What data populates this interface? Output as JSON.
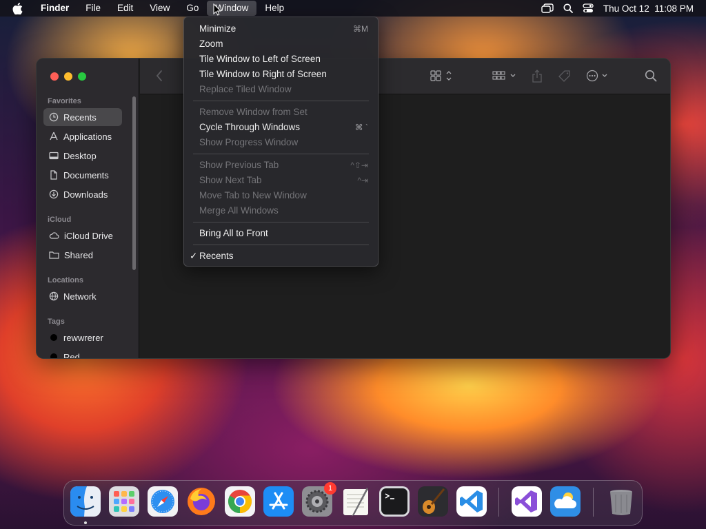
{
  "menubar": {
    "app_name": "Finder",
    "items": [
      "File",
      "Edit",
      "View",
      "Go",
      "Window",
      "Help"
    ],
    "active_menu": "Window",
    "clock": "Thu Oct 12  11:08 PM"
  },
  "window_menu": {
    "items": [
      {
        "label": "Minimize",
        "shortcut": "⌘M",
        "enabled": true
      },
      {
        "label": "Zoom",
        "shortcut": "",
        "enabled": true
      },
      {
        "label": "Tile Window to Left of Screen",
        "shortcut": "",
        "enabled": true
      },
      {
        "label": "Tile Window to Right of Screen",
        "shortcut": "",
        "enabled": true
      },
      {
        "label": "Replace Tiled Window",
        "shortcut": "",
        "enabled": false
      },
      {
        "label": "Remove Window from Set",
        "shortcut": "",
        "enabled": false
      },
      {
        "label": "Cycle Through Windows",
        "shortcut": "⌘ `",
        "enabled": true
      },
      {
        "label": "Show Progress Window",
        "shortcut": "",
        "enabled": false
      },
      {
        "label": "Show Previous Tab",
        "shortcut": "^⇧⇥",
        "enabled": false
      },
      {
        "label": "Show Next Tab",
        "shortcut": "^⇥",
        "enabled": false
      },
      {
        "label": "Move Tab to New Window",
        "shortcut": "",
        "enabled": false
      },
      {
        "label": "Merge All Windows",
        "shortcut": "",
        "enabled": false
      },
      {
        "label": "Bring All to Front",
        "shortcut": "",
        "enabled": true
      },
      {
        "label": "Recents",
        "shortcut": "",
        "enabled": true,
        "checked": true
      }
    ]
  },
  "sidebar": {
    "sections": {
      "favorites": "Favorites",
      "icloud": "iCloud",
      "locations": "Locations",
      "tags": "Tags"
    },
    "favorites": [
      {
        "label": "Recents",
        "icon": "clock-icon",
        "selected": true
      },
      {
        "label": "Applications",
        "icon": "applications-icon"
      },
      {
        "label": "Desktop",
        "icon": "desktop-icon"
      },
      {
        "label": "Documents",
        "icon": "document-icon"
      },
      {
        "label": "Downloads",
        "icon": "download-icon"
      }
    ],
    "icloud": [
      {
        "label": "iCloud Drive",
        "icon": "cloud-icon"
      },
      {
        "label": "Shared",
        "icon": "shared-folder-icon"
      }
    ],
    "locations": [
      {
        "label": "Network",
        "icon": "globe-icon"
      }
    ],
    "tags": [
      {
        "label": "rewwrerer",
        "color": "#000000"
      },
      {
        "label": "Red",
        "color": "#000000"
      }
    ]
  },
  "dock": {
    "apps": [
      {
        "name": "Finder",
        "icon": "finder-icon"
      },
      {
        "name": "Launchpad",
        "icon": "launchpad-icon"
      },
      {
        "name": "Safari",
        "icon": "safari-icon"
      },
      {
        "name": "Firefox",
        "icon": "firefox-icon"
      },
      {
        "name": "Chrome",
        "icon": "chrome-icon"
      },
      {
        "name": "App Store",
        "icon": "app-store-icon"
      },
      {
        "name": "System Settings",
        "icon": "settings-icon",
        "badge": "1"
      },
      {
        "name": "TextEdit",
        "icon": "textedit-icon"
      },
      {
        "name": "Terminal",
        "icon": "terminal-icon"
      },
      {
        "name": "GarageBand",
        "icon": "guitar-icon"
      },
      {
        "name": "Visual Studio Code",
        "icon": "vscode-icon"
      },
      {
        "name": "Visual Studio",
        "icon": "visual-studio-icon"
      },
      {
        "name": "Weather",
        "icon": "weather-icon"
      },
      {
        "name": "Trash",
        "icon": "trash-icon"
      }
    ]
  },
  "colors": {
    "menu_bg": "#28282c",
    "selected_sidebar": "#46444a",
    "badge": "#ff3b30"
  }
}
